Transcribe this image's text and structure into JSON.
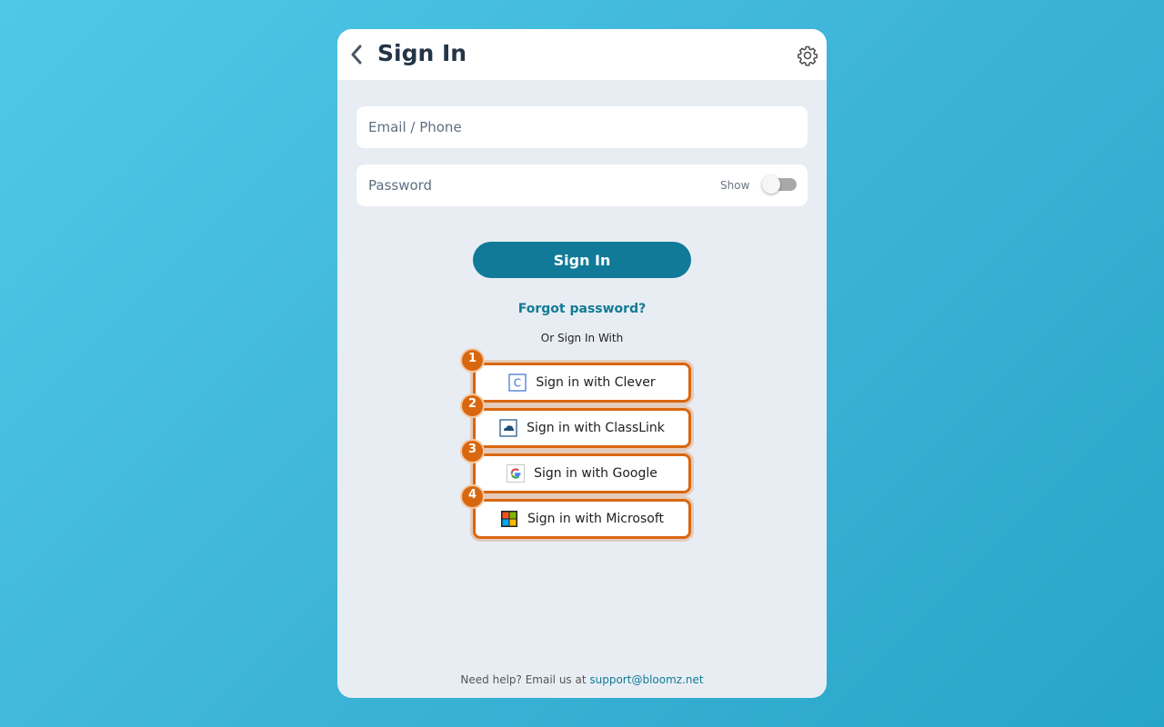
{
  "header": {
    "title": "Sign In"
  },
  "form": {
    "email_placeholder": "Email / Phone",
    "password_placeholder": "Password",
    "show_label": "Show",
    "show_password_enabled": false,
    "sign_in_label": "Sign In",
    "forgot_label": "Forgot password?",
    "or_label": "Or Sign In With"
  },
  "sso": [
    {
      "number": "1",
      "label": "Sign in with Clever",
      "icon": "clever-icon"
    },
    {
      "number": "2",
      "label": "Sign in with ClassLink",
      "icon": "classlink-icon"
    },
    {
      "number": "3",
      "label": "Sign in with Google",
      "icon": "google-icon"
    },
    {
      "number": "4",
      "label": "Sign in with Microsoft",
      "icon": "microsoft-icon"
    }
  ],
  "footer": {
    "help_text": "Need help? Email us at ",
    "email": "support@bloomz.net"
  },
  "colors": {
    "primary": "#107a98",
    "highlight": "#d9670f",
    "title": "#233547"
  }
}
